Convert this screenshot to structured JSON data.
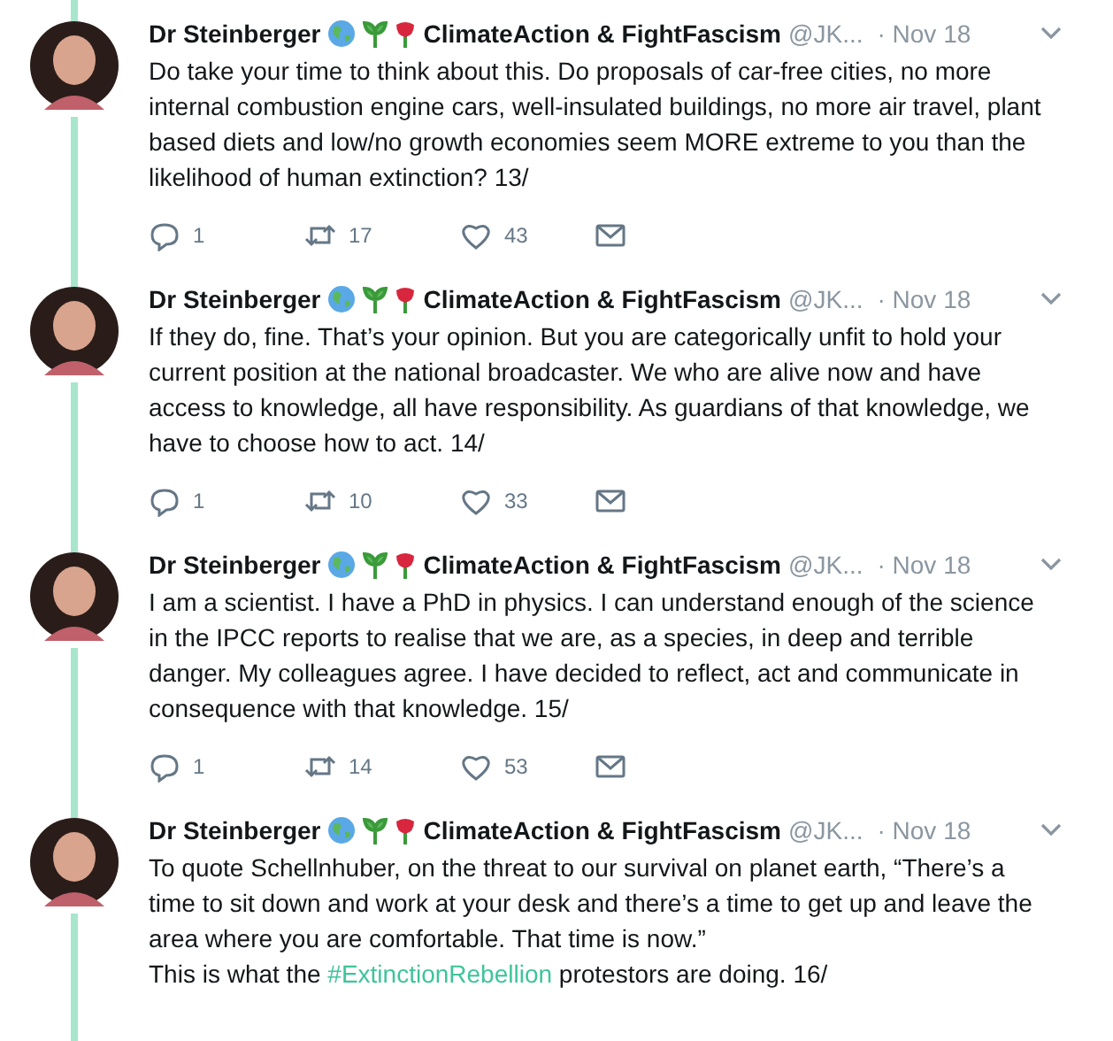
{
  "tweets": [
    {
      "name": "Dr Steinberger",
      "name_suffix": "ClimateAction & FightFascism",
      "handle": "@JK...",
      "date": "· Nov 18",
      "body": [
        {
          "kind": "plain",
          "text": "Do take your time to think about this. Do proposals of car-free cities, no more internal combustion engine cars, well-insulated buildings, no more air travel, plant based diets and low/no growth economies seem MORE extreme to you than the likelihood of human extinction? 13/"
        }
      ],
      "replies": "1",
      "retweets": "17",
      "likes": "43"
    },
    {
      "name": "Dr Steinberger",
      "name_suffix": "ClimateAction & FightFascism",
      "handle": "@JK...",
      "date": "· Nov 18",
      "body": [
        {
          "kind": "plain",
          "text": "If they do, fine. That’s your opinion. But you are categorically unfit to hold your current position at the national broadcaster. We who are alive now and have access to knowledge, all have responsibility. As guardians of that knowledge, we have to choose how to act. 14/"
        }
      ],
      "replies": "1",
      "retweets": "10",
      "likes": "33"
    },
    {
      "name": "Dr Steinberger",
      "name_suffix": "ClimateAction & FightFascism",
      "handle": "@JK...",
      "date": "· Nov 18",
      "body": [
        {
          "kind": "plain",
          "text": "I am a scientist. I have a PhD in physics. I can understand enough of the science in the IPCC reports to realise that we are, as a species, in deep and terrible danger. My colleagues agree. I have decided to reflect, act and communicate in consequence with that knowledge. 15/"
        }
      ],
      "replies": "1",
      "retweets": "14",
      "likes": "53"
    },
    {
      "name": "Dr Steinberger",
      "name_suffix": "ClimateAction & FightFascism",
      "handle": "@JK...",
      "date": "· Nov 18",
      "body": [
        {
          "kind": "plain",
          "text": "To quote Schellnhuber, on the threat to our survival on planet earth, “There’s a time to sit down and work at your desk and there’s a time to  get up and leave the area where you are comfortable. That time is now.”\nThis is what the "
        },
        {
          "kind": "hashtag",
          "text": "#ExtinctionRebellion"
        },
        {
          "kind": "plain",
          "text": " protestors are doing. 16/"
        }
      ]
    }
  ]
}
